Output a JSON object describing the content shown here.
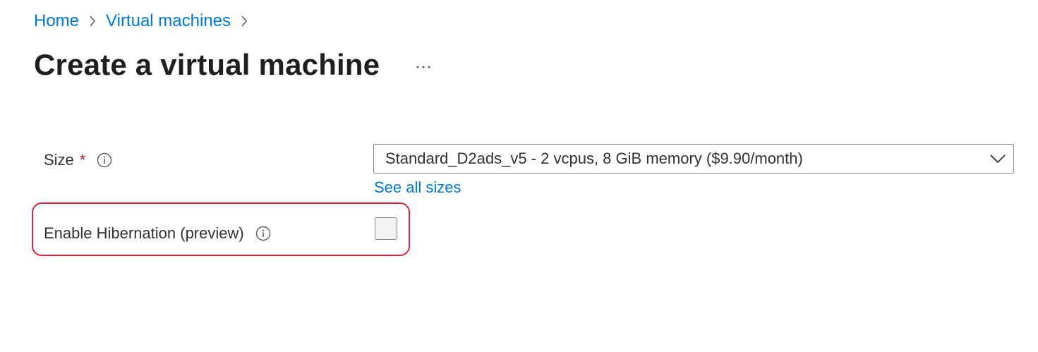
{
  "breadcrumb": {
    "items": [
      {
        "label": "Home"
      },
      {
        "label": "Virtual machines"
      }
    ],
    "separator_icon": "chevron-right-icon"
  },
  "page": {
    "title": "Create a virtual machine",
    "more_label": "..."
  },
  "form": {
    "size": {
      "label": "Size",
      "required_mark": "*",
      "value": "Standard_D2ads_v5 - 2 vcpus, 8 GiB memory ($9.90/month)",
      "see_all_link": "See all sizes"
    },
    "hibernation": {
      "label": "Enable Hibernation (preview)",
      "checked": false
    }
  },
  "colors": {
    "link": "#0078d4",
    "required": "#a4262c",
    "highlight_border": "#d7263d"
  }
}
